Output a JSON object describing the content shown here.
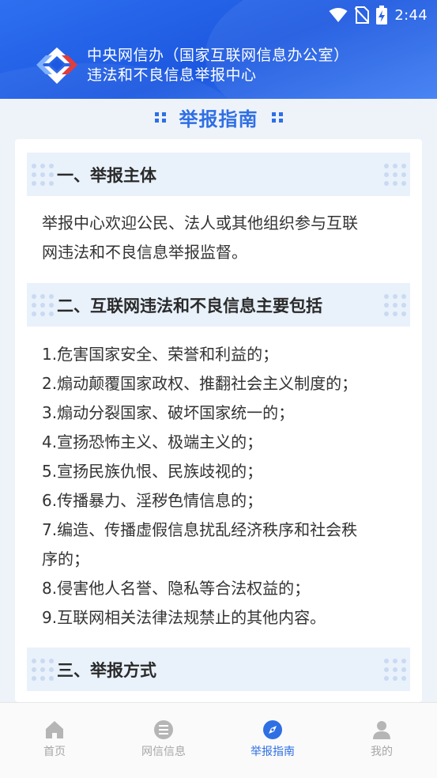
{
  "status_bar": {
    "time": "2:44",
    "icons": [
      "wifi-icon",
      "no-sim-icon",
      "battery-charging-icon"
    ]
  },
  "header": {
    "org_line1": "中央网信办（国家互联网信息办公室）",
    "org_line2": "违法和不良信息举报中心"
  },
  "page_title": "举报指南",
  "sections": [
    {
      "title": "一、举报主体"
    },
    {
      "title": "二、互联网违法和不良信息主要包括"
    },
    {
      "title": "三、举报方式"
    }
  ],
  "section1_body": [
    "举报中心欢迎公民、法人或其他组织参与互联",
    "网违法和不良信息举报监督。"
  ],
  "section2_items": [
    "1.危害国家安全、荣誉和利益的；",
    "2.煽动颠覆国家政权、推翻社会主义制度的；",
    "3.煽动分裂国家、破坏国家统一的；",
    "4.宣扬恐怖主义、极端主义的；",
    "5.宣扬民族仇恨、民族歧视的；",
    "6.传播暴力、淫秽色情信息的；",
    "7.编造、传播虚假信息扰乱经济秩序和社会秩",
    "序的；",
    "8.侵害他人名誉、隐私等合法权益的；",
    "9.互联网相关法律法规禁止的其他内容。"
  ],
  "tabs": [
    {
      "label": "首页",
      "icon": "home-icon",
      "active": false
    },
    {
      "label": "网信信息",
      "icon": "list-icon",
      "active": false
    },
    {
      "label": "举报指南",
      "icon": "compass-icon",
      "active": true
    },
    {
      "label": "我的",
      "icon": "user-icon",
      "active": false
    }
  ],
  "colors": {
    "accent": "#2f6fe4",
    "header": "#1c58e0",
    "section_bg": "#e9f1fb",
    "inactive_tab": "#a7a7a7"
  }
}
